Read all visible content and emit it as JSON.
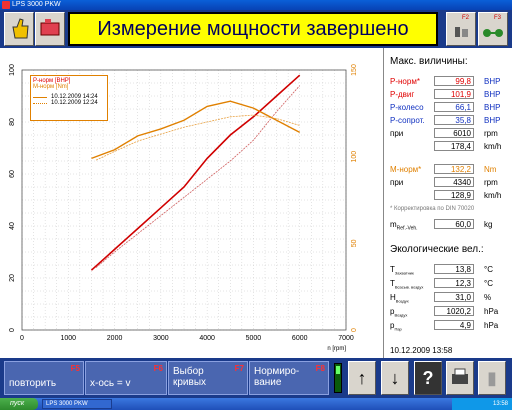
{
  "window": {
    "title": "LPS 3000 PKW"
  },
  "banner": {
    "text": "Измерение мощности завершено"
  },
  "topkeys": {
    "f2": "F2",
    "f3": "F3"
  },
  "colors": {
    "p_norm": "#e00000",
    "p_dvig": "#c00000",
    "power_thin": "#d04040",
    "m_norm": "#e08000",
    "grid": "#b0b0b0"
  },
  "legend": {
    "p_label": "P-норм [BHP]",
    "m_label": "M-норм [Nm]",
    "date1": "10.12.2009 14:24",
    "date2": "10.12.2009 12:24"
  },
  "chart_data": {
    "type": "line",
    "xlabel": "n [rpm]",
    "xlim": [
      0,
      7000
    ],
    "xticks": [
      0,
      1000,
      2000,
      3000,
      4000,
      5000,
      6000,
      7000
    ],
    "ylim_left": [
      0,
      100
    ],
    "yticks_left": [
      0,
      20,
      40,
      60,
      80,
      100
    ],
    "ylim_right": [
      0,
      150
    ],
    "yticks_right": [
      0,
      50,
      100,
      150
    ],
    "series": [
      {
        "name": "P-норм [BHP]",
        "run": "10.12.2009 14:24",
        "axis": "left",
        "x": [
          1500,
          2000,
          2500,
          3000,
          3500,
          4000,
          4500,
          5000,
          5500,
          6000
        ],
        "y": [
          23,
          31,
          39,
          47,
          55,
          66,
          75,
          82,
          90,
          98
        ]
      },
      {
        "name": "P-норм [BHP]",
        "run": "10.12.2009 12:24",
        "axis": "left",
        "x": [
          1600,
          2000,
          2500,
          3000,
          3500,
          4000,
          4500,
          5000,
          5500,
          6000
        ],
        "y": [
          24,
          30,
          37,
          44,
          51,
          58,
          65,
          73,
          84,
          94
        ]
      },
      {
        "name": "M-норм [Nm]",
        "run": "10.12.2009 14:24",
        "axis": "right",
        "x": [
          1500,
          2000,
          2500,
          3000,
          3500,
          4000,
          4500,
          5000,
          5500,
          6000
        ],
        "y": [
          99,
          104,
          112,
          116,
          121,
          129,
          132,
          128,
          121,
          114
        ]
      },
      {
        "name": "M-норм [Nm]",
        "run": "10.12.2009 12:24",
        "axis": "right",
        "x": [
          1600,
          2000,
          2500,
          3000,
          3500,
          4000,
          4500,
          5000,
          5500,
          6000
        ],
        "y": [
          98,
          103,
          109,
          113,
          117,
          120,
          123,
          124,
          122,
          118
        ]
      }
    ]
  },
  "side": {
    "max_title": "Макс. виличины:",
    "rows": [
      {
        "label": "P-норм*",
        "value": "99,8",
        "unit": "BHP",
        "cls": "red"
      },
      {
        "label": "P-двиг",
        "value": "101,9",
        "unit": "BHP",
        "cls": "red"
      },
      {
        "label": "P-колесо",
        "value": "66,1",
        "unit": "BHP",
        "cls": "blue"
      },
      {
        "label": "P-сопрот.",
        "value": "35,8",
        "unit": "BHP",
        "cls": "blue"
      },
      {
        "label": "при",
        "value": "6010",
        "unit": "rpm",
        "cls": ""
      },
      {
        "label": "",
        "value": "178,4",
        "unit": "km/h",
        "cls": ""
      },
      {
        "label": "M-норм*",
        "value": "132,2",
        "unit": "Nm",
        "cls": "org"
      },
      {
        "label": "при",
        "value": "4340",
        "unit": "rpm",
        "cls": ""
      },
      {
        "label": "",
        "value": "128,9",
        "unit": "km/h",
        "cls": ""
      }
    ],
    "din_note": "* Корректировка по DIN 70020",
    "mass_label": "m",
    "mass_sub": "Ref.-Veh.",
    "mass_value": "60,0",
    "mass_unit": "kg",
    "eco_title": "Экологические вел.:",
    "eco": [
      {
        "label": "T",
        "sub": "Захватник",
        "value": "13,8",
        "unit": "°C"
      },
      {
        "label": "T",
        "sub": "Всасыв. воздух",
        "value": "12,3",
        "unit": "°C"
      },
      {
        "label": "H",
        "sub": "Воздух",
        "value": "31,0",
        "unit": "%"
      },
      {
        "label": "p",
        "sub": "Воздух",
        "value": "1020,2",
        "unit": "hPa"
      },
      {
        "label": "p",
        "sub": "Пар",
        "value": "4,9",
        "unit": "hPa"
      }
    ],
    "datetime": "10.12.2009  13:58"
  },
  "buttons": [
    {
      "label": "повторить",
      "fk": "F5"
    },
    {
      "label": "x-ось = v",
      "fk": "F6"
    },
    {
      "label": "Выбор кривых",
      "fk": "F7"
    },
    {
      "label": "Нормиро-вание",
      "fk": "F8"
    }
  ],
  "taskbar": {
    "start": "пуск",
    "task": "LPS 3000 PKW",
    "clock": "13:58"
  }
}
